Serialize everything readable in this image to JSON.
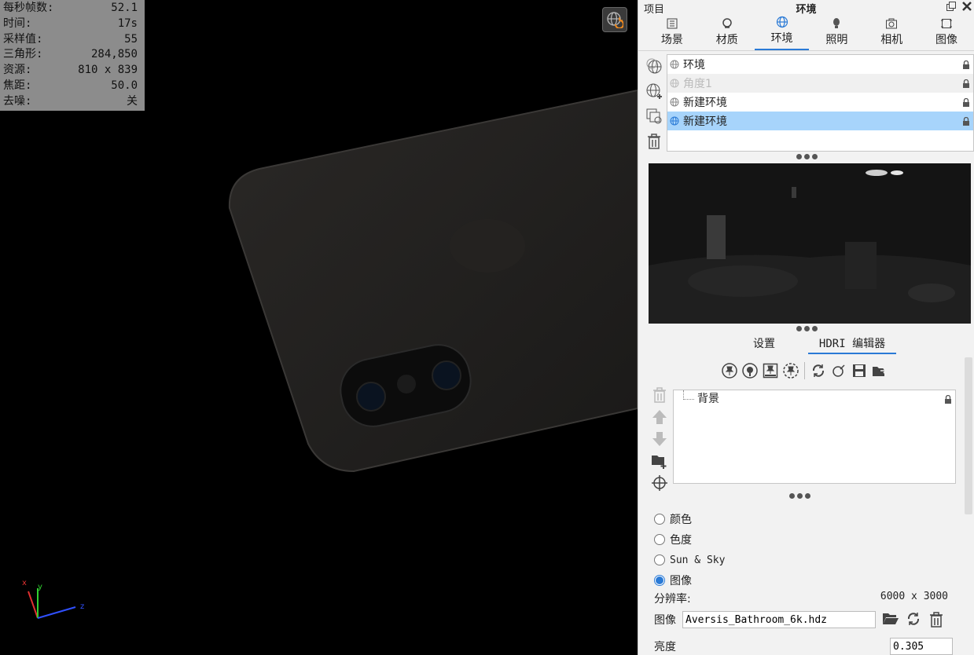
{
  "stats": [
    {
      "label": "每秒帧数:",
      "value": "52.1"
    },
    {
      "label": "时间:",
      "value": "17s"
    },
    {
      "label": "采样值:",
      "value": "55"
    },
    {
      "label": "三角形:",
      "value": "284,850"
    },
    {
      "label": "资源:",
      "value": "810 x 839"
    },
    {
      "label": "焦距:",
      "value": "50.0"
    },
    {
      "label": "去噪:",
      "value": "关"
    }
  ],
  "axis": {
    "x": "x",
    "y": "y",
    "z": "z"
  },
  "panel": {
    "project_label": "项目",
    "title": "环境"
  },
  "tabs": [
    {
      "label": "场景",
      "icon": "scene-icon"
    },
    {
      "label": "材质",
      "icon": "material-icon"
    },
    {
      "label": "环境",
      "icon": "globe-icon",
      "active": true
    },
    {
      "label": "照明",
      "icon": "bulb-icon"
    },
    {
      "label": "相机",
      "icon": "camera-icon"
    },
    {
      "label": "图像",
      "icon": "image-icon"
    }
  ],
  "environments": [
    {
      "label": "环境",
      "state": "normal"
    },
    {
      "label": "角度1",
      "state": "dim"
    },
    {
      "label": "新建环境",
      "state": "normal"
    },
    {
      "label": "新建环境",
      "state": "selected"
    }
  ],
  "subtabs": {
    "settings": "设置",
    "hdri_editor": "HDRI 编辑器"
  },
  "layers": [
    {
      "label": "背景"
    }
  ],
  "background": {
    "options": [
      "颜色",
      "色度",
      "Sun & Sky",
      "图像"
    ],
    "selected": "图像"
  },
  "resolution": {
    "label": "分辨率:",
    "value": "6000 x 3000"
  },
  "image": {
    "label": "图像",
    "file": "Aversis_Bathroom_6k.hdz"
  },
  "brightness": {
    "label": "亮度",
    "value": "0.305"
  },
  "colors": {
    "accent": "#2a7ad6",
    "selected_row": "#a7d4fb",
    "stats_bg": "#8c8c8c"
  }
}
